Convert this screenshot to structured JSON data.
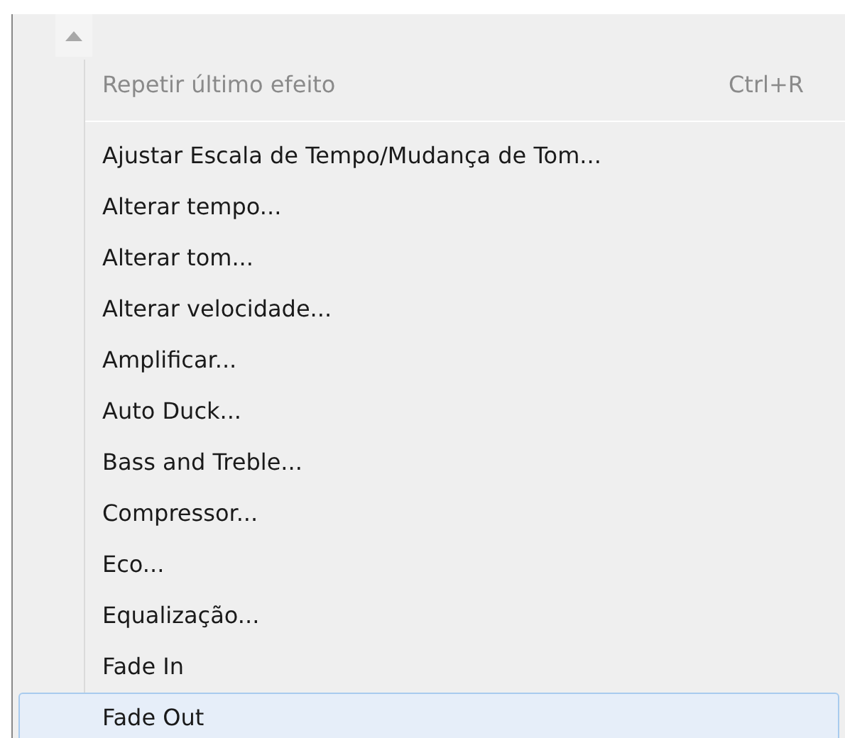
{
  "scroll_up": {
    "disabled": true
  },
  "items": [
    {
      "kind": "command",
      "label": "Repetir último efeito",
      "shortcut": "Ctrl+R",
      "disabled": true,
      "selected": false
    },
    {
      "kind": "separator"
    },
    {
      "kind": "command",
      "label": "Ajustar Escala de Tempo/Mudança de Tom...",
      "disabled": false,
      "selected": false
    },
    {
      "kind": "command",
      "label": "Alterar tempo...",
      "disabled": false,
      "selected": false
    },
    {
      "kind": "command",
      "label": "Alterar tom...",
      "disabled": false,
      "selected": false
    },
    {
      "kind": "command",
      "label": "Alterar velocidade...",
      "disabled": false,
      "selected": false
    },
    {
      "kind": "command",
      "label": "Amplificar...",
      "disabled": false,
      "selected": false
    },
    {
      "kind": "command",
      "label": "Auto Duck...",
      "disabled": false,
      "selected": false
    },
    {
      "kind": "command",
      "label": "Bass and Treble...",
      "disabled": false,
      "selected": false
    },
    {
      "kind": "command",
      "label": "Compressor...",
      "disabled": false,
      "selected": false
    },
    {
      "kind": "command",
      "label": "Eco...",
      "disabled": false,
      "selected": false
    },
    {
      "kind": "command",
      "label": "Equalização...",
      "disabled": false,
      "selected": false
    },
    {
      "kind": "command",
      "label": "Fade In",
      "disabled": false,
      "selected": false
    },
    {
      "kind": "command",
      "label": "Fade Out",
      "disabled": false,
      "selected": true
    }
  ]
}
